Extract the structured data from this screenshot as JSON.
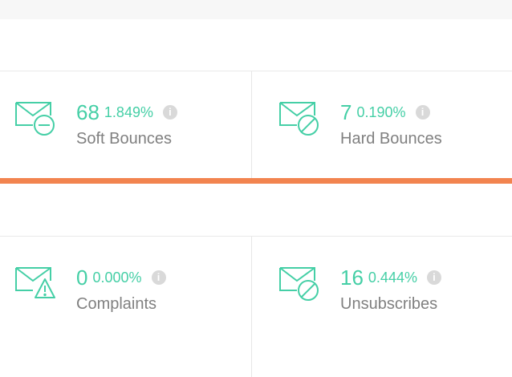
{
  "colors": {
    "accent": "#f2844f",
    "teal": "#45cfa6"
  },
  "stats": [
    {
      "count": "68",
      "percent": "1.849%",
      "label": "Soft Bounces",
      "icon": "mail-minus-icon"
    },
    {
      "count": "7",
      "percent": "0.190%",
      "label": "Hard Bounces",
      "icon": "mail-blocked-icon"
    },
    {
      "count": "0",
      "percent": "0.000%",
      "label": "Complaints",
      "icon": "mail-warning-icon"
    },
    {
      "count": "16",
      "percent": "0.444%",
      "label": "Unsubscribes",
      "icon": "mail-blocked-icon"
    }
  ],
  "info_glyph": "i"
}
